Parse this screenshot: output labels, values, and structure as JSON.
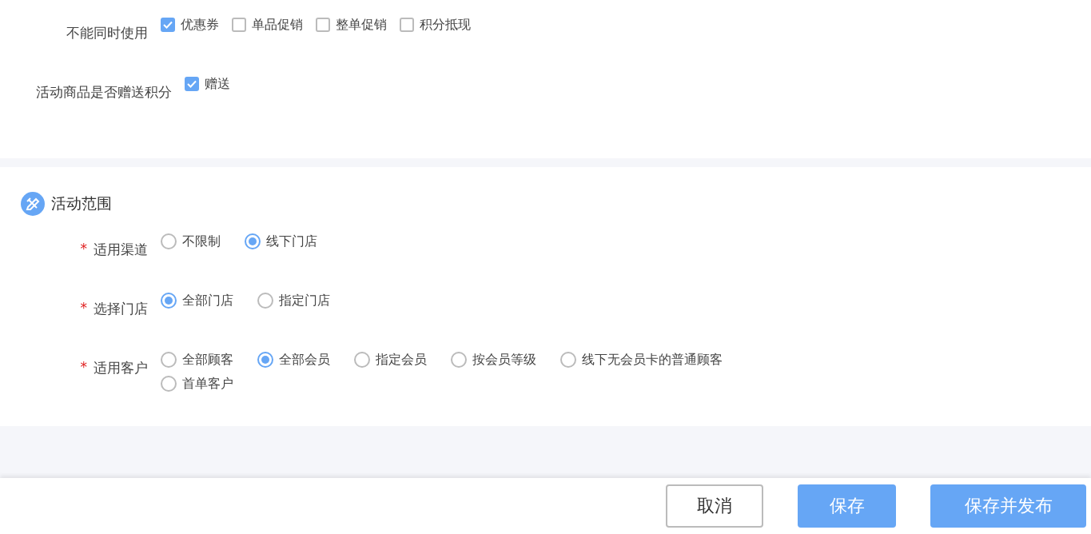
{
  "sections": [
    {
      "rows": [
        {
          "label": "不能同时使用",
          "kind": "checkbox",
          "options": [
            {
              "label": "优惠券",
              "checked": true
            },
            {
              "label": "单品促销",
              "checked": false
            },
            {
              "label": "整单促销",
              "checked": false
            },
            {
              "label": "积分抵现",
              "checked": false
            }
          ]
        },
        {
          "label": "活动商品是否赠送积分",
          "kind": "checkbox",
          "options": [
            {
              "label": "赠送",
              "checked": true
            }
          ]
        }
      ]
    },
    {
      "title": "活动范围",
      "rows": [
        {
          "marker": "*",
          "label": "适用渠道",
          "kind": "radio",
          "options": [
            {
              "label": "不限制",
              "selected": false
            },
            {
              "label": "线下门店",
              "selected": true
            }
          ]
        },
        {
          "marker": "*",
          "label": "选择门店",
          "kind": "radio",
          "options": [
            {
              "label": "全部门店",
              "selected": true
            },
            {
              "label": "指定门店",
              "selected": false
            }
          ]
        },
        {
          "marker": "*",
          "label": "适用客户",
          "kind": "radio",
          "options": [
            {
              "label": "全部顾客",
              "selected": false
            },
            {
              "label": "全部会员",
              "selected": true
            },
            {
              "label": "指定会员",
              "selected": false
            },
            {
              "label": "按会员等级",
              "selected": false
            },
            {
              "label": "线下无会员卡的普通顾客",
              "selected": false
            },
            {
              "label": "首单客户",
              "selected": false
            }
          ]
        }
      ]
    }
  ],
  "buttons": [
    {
      "label": "取消",
      "kind": "secondary"
    },
    {
      "label": "保存",
      "kind": "primary"
    },
    {
      "label": "保存并发布",
      "kind": "primary"
    }
  ]
}
